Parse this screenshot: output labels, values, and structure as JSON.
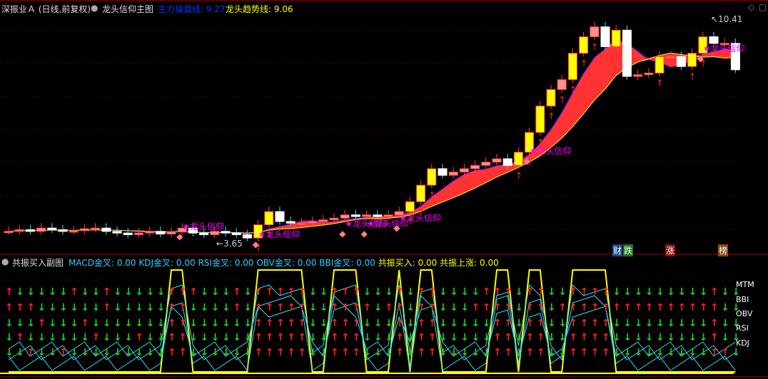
{
  "main": {
    "stock": "深振业Ａ",
    "period": "(日线,前复权)",
    "indicator": "龙头信仰主图",
    "line1_label": "主力操盘线",
    "line1_value": "9.27",
    "line2_label": "龙头趋势线",
    "line2_value": "9.06",
    "high_label": "10.41",
    "low_label": "3.65",
    "signal_label": "龙头信仰",
    "colors": {
      "line1": "#0000ff",
      "line2": "#ffff00",
      "band": "#ff3333",
      "signal": "#ff00ff"
    }
  },
  "badges": [
    {
      "text": "财",
      "color": "#1c4a8c"
    },
    {
      "text": "跌",
      "color": "#1b7a1b"
    },
    {
      "text": "涨",
      "color": "#8a1010"
    },
    {
      "text": "榜",
      "color": "#8a4a10"
    }
  ],
  "sub": {
    "title": "共振买入副图",
    "items": [
      {
        "label": "MACD金叉",
        "value": "0.00"
      },
      {
        "label": "KDJ金叉",
        "value": "0.00"
      },
      {
        "label": "RSI金叉",
        "value": "0.00"
      },
      {
        "label": "OBV金叉",
        "value": "0.00"
      },
      {
        "label": "BBI金叉",
        "value": "0.00"
      }
    ],
    "buy_label": "共振买入",
    "buy_value": "0.00",
    "rise_label": "共振上涨",
    "rise_value": "0.00",
    "rows": [
      "MTM",
      "BBI",
      "OBV",
      "RSI",
      "KDJ"
    ],
    "signal": "00000000000000011000000111110011100010110000011011001111000000000000",
    "row_states": [
      "10000010010000011100010111110011100010110000111011001111000000000100",
      "11100000010000011000010111110011110110110001111011011111111111111100",
      "00010001000000011000000111110011100010110000011011001111000000000100",
      "01000000100010011000000111110011100010110000011011001111000000000100",
      "00100100000000011000000111110011100010110000011011001111000000000110"
    ]
  },
  "chart_data": {
    "type": "candlestick",
    "closes": [
      4.0,
      4.05,
      4.0,
      4.1,
      4.05,
      4.0,
      4.02,
      4.08,
      4.1,
      4.0,
      3.95,
      3.9,
      3.95,
      4.0,
      3.92,
      3.98,
      4.1,
      3.95,
      3.9,
      4.0,
      3.95,
      3.9,
      3.8,
      4.2,
      4.6,
      4.3,
      4.25,
      4.25,
      4.3,
      4.35,
      4.4,
      4.5,
      4.45,
      4.5,
      4.45,
      4.5,
      4.6,
      4.9,
      5.4,
      5.9,
      5.7,
      5.8,
      5.9,
      6.0,
      6.1,
      6.2,
      6.0,
      6.4,
      7.0,
      7.8,
      8.3,
      8.6,
      9.4,
      9.9,
      10.2,
      9.6,
      10.1,
      8.7,
      8.75,
      8.8,
      9.3,
      9.3,
      9.0,
      9.4,
      9.9,
      9.7,
      9.7,
      8.9
    ]
  }
}
